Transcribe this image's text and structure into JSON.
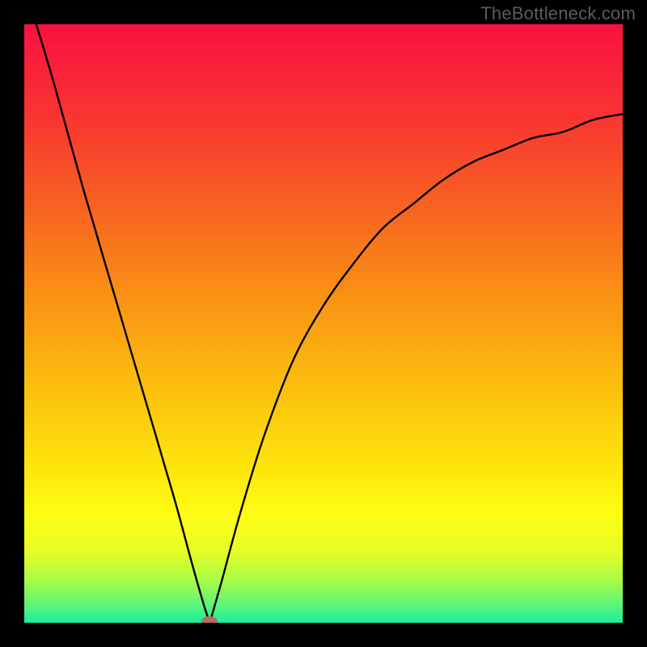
{
  "watermark": "TheBottleneck.com",
  "colors": {
    "frame": "#000000",
    "curve": "#000000",
    "marker": "#bb6b62",
    "gradient_stops": [
      {
        "offset": 0.0,
        "color": "#f9113f"
      },
      {
        "offset": 0.15,
        "color": "#f83432"
      },
      {
        "offset": 0.3,
        "color": "#f76122"
      },
      {
        "offset": 0.45,
        "color": "#f99015"
      },
      {
        "offset": 0.6,
        "color": "#fbbd0e"
      },
      {
        "offset": 0.75,
        "color": "#fee80c"
      },
      {
        "offset": 0.82,
        "color": "#fefd14"
      },
      {
        "offset": 0.88,
        "color": "#e7fd25"
      },
      {
        "offset": 0.93,
        "color": "#a7fb48"
      },
      {
        "offset": 0.97,
        "color": "#5cf579"
      },
      {
        "offset": 1.0,
        "color": "#1aee9e"
      }
    ]
  },
  "chart_data": {
    "type": "line",
    "title": "",
    "xlabel": "",
    "ylabel": "",
    "xlim": [
      0,
      100
    ],
    "ylim": [
      0,
      100
    ],
    "min_point": {
      "x": 31,
      "y": 0
    },
    "series": [
      {
        "name": "left-branch",
        "x": [
          2,
          5,
          10,
          15,
          20,
          25,
          28,
          30,
          31
        ],
        "y": [
          100,
          90,
          72,
          55,
          38,
          21,
          10,
          3,
          0
        ]
      },
      {
        "name": "right-branch",
        "x": [
          31,
          33,
          36,
          40,
          45,
          50,
          55,
          60,
          65,
          70,
          75,
          80,
          85,
          90,
          95,
          100
        ],
        "y": [
          0,
          7,
          18,
          31,
          44,
          53,
          60,
          66,
          70,
          74,
          77,
          79,
          81,
          82,
          84,
          85
        ]
      }
    ]
  }
}
